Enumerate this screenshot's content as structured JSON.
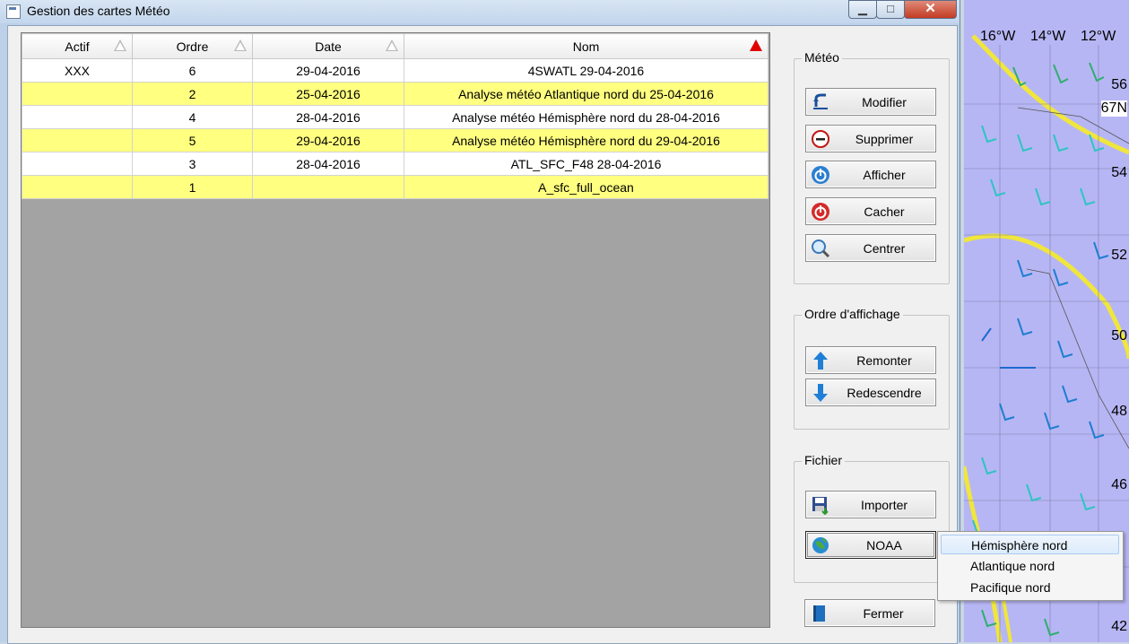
{
  "window": {
    "title": "Gestion des cartes Météo",
    "close_glyph": "✕",
    "min_glyph": "▁",
    "max_glyph": "□"
  },
  "table": {
    "columns": [
      "Actif",
      "Ordre",
      "Date",
      "Nom"
    ],
    "sorted_column": "Nom",
    "rows": [
      {
        "actif": "XXX",
        "ordre": "6",
        "date": "29-04-2016",
        "nom": "4SWATL 29-04-2016",
        "highlight": false
      },
      {
        "actif": "",
        "ordre": "2",
        "date": "25-04-2016",
        "nom": "Analyse météo Atlantique nord du 25-04-2016",
        "highlight": true
      },
      {
        "actif": "",
        "ordre": "4",
        "date": "28-04-2016",
        "nom": "Analyse météo Hémisphère nord du 28-04-2016",
        "highlight": false
      },
      {
        "actif": "",
        "ordre": "5",
        "date": "29-04-2016",
        "nom": "Analyse météo Hémisphère nord du 29-04-2016",
        "highlight": true
      },
      {
        "actif": "",
        "ordre": "3",
        "date": "28-04-2016",
        "nom": "ATL_SFC_F48 28-04-2016",
        "highlight": false
      },
      {
        "actif": "",
        "ordre": "1",
        "date": "",
        "nom": "A_sfc_full_ocean",
        "highlight": true
      }
    ]
  },
  "groups": {
    "meteo": {
      "label": "Météo",
      "buttons": [
        {
          "label": "Modifier",
          "icon": "edit-arrow-icon"
        },
        {
          "label": "Supprimer",
          "icon": "minus-circle-icon"
        },
        {
          "label": "Afficher",
          "icon": "power-blue-icon"
        },
        {
          "label": "Cacher",
          "icon": "power-red-icon"
        },
        {
          "label": "Centrer",
          "icon": "magnifier-icon"
        }
      ]
    },
    "ordre": {
      "label": "Ordre d'affichage",
      "buttons": [
        {
          "label": "Remonter",
          "icon": "arrow-up-icon"
        },
        {
          "label": "Redescendre",
          "icon": "arrow-down-icon"
        }
      ]
    },
    "fichier": {
      "label": "Fichier",
      "buttons": [
        {
          "label": "Importer",
          "icon": "floppy-import-icon"
        },
        {
          "label": "NOAA",
          "icon": "globe-icon"
        }
      ]
    }
  },
  "close_button": {
    "label": "Fermer",
    "icon": "book-icon"
  },
  "dropdown": {
    "items": [
      "Hémisphère nord",
      "Atlantique nord",
      "Pacifique nord"
    ],
    "hovered": "Hémisphère nord"
  },
  "map": {
    "longitudes": [
      "16°W",
      "14°W",
      "12°W"
    ],
    "latitudes": [
      "56",
      "67N",
      "54",
      "52",
      "50",
      "48",
      "46",
      "42"
    ],
    "colors": {
      "background": "#b7b6f4",
      "isobar": "#f0e63c"
    }
  },
  "colors": {
    "row_highlight": "#ffff80",
    "grid_empty": "#a3a3a3",
    "sort_active": "#e00000"
  }
}
